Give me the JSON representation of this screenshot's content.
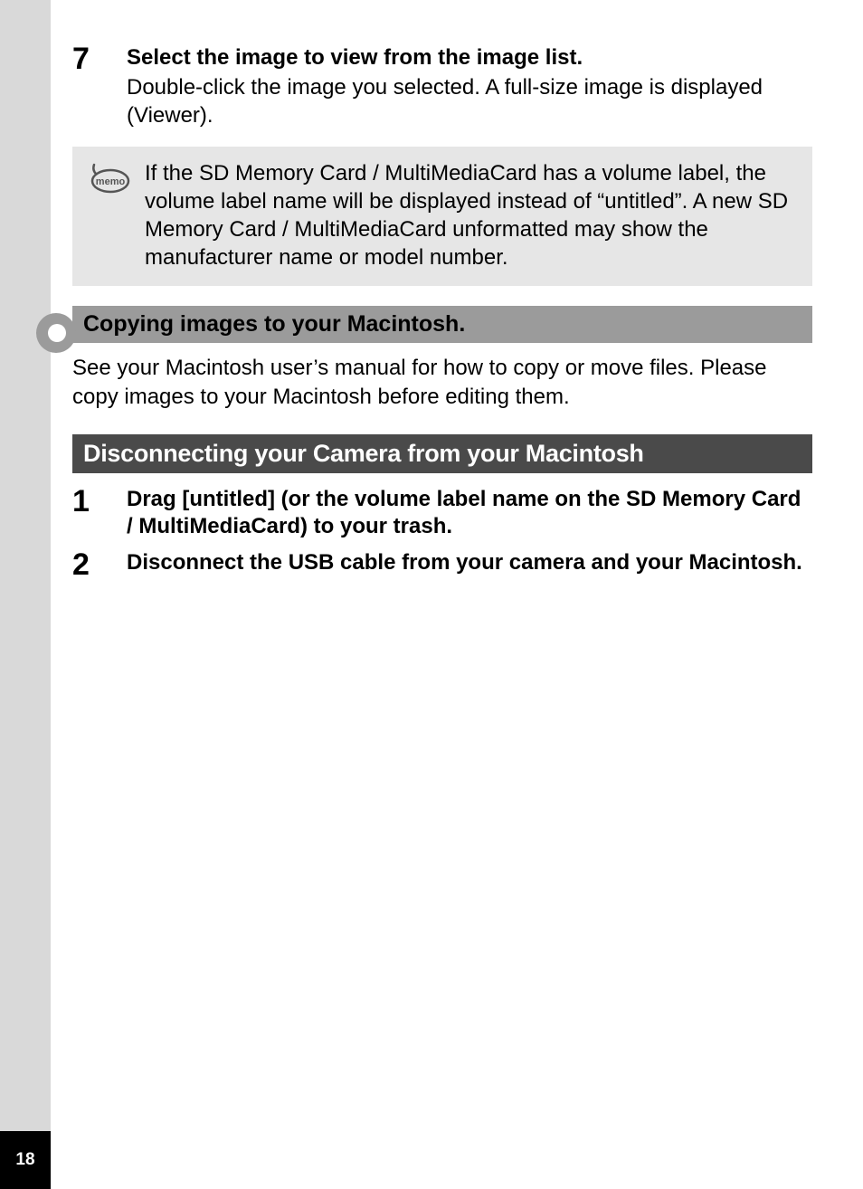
{
  "page_number": "18",
  "step7": {
    "num": "7",
    "title": "Select the image to view from the image list.",
    "desc": "Double-click the image you selected. A full-size image is displayed (Viewer)."
  },
  "memo": {
    "icon_label": "memo",
    "text": "If the SD Memory Card / MultiMediaCard has a volume label, the volume label name will be displayed instead of “untitled”. A new SD Memory Card / MultiMediaCard unformatted may show the manufacturer name or model number."
  },
  "sub_heading": "Copying images to your Macintosh.",
  "body_text": "See your Macintosh user’s manual for how to copy or move files. Please copy images to your Macintosh before editing them.",
  "section_heading": "Disconnecting your Camera from your Macintosh",
  "steps2": {
    "s1": {
      "num": "1",
      "title": "Drag [untitled] (or the volume label name on the SD Memory Card / MultiMediaCard) to your trash."
    },
    "s2": {
      "num": "2",
      "title": "Disconnect the USB cable from your camera and your Macintosh."
    }
  }
}
